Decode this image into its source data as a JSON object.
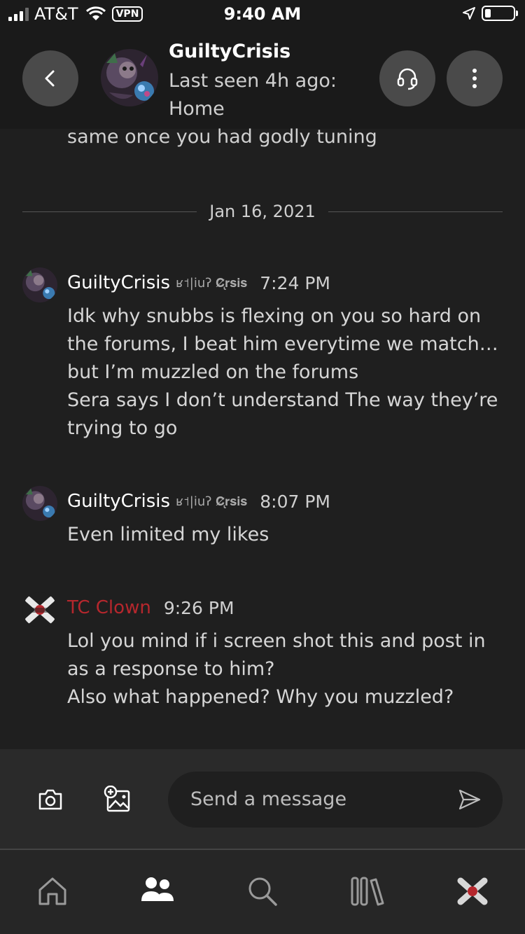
{
  "status_bar": {
    "carrier": "AT&T",
    "vpn": "VPN",
    "time": "9:40 AM"
  },
  "header": {
    "name": "GuiltyCrisis",
    "status": "Last seen 4h ago: Home",
    "icons": [
      "back-arrow-icon",
      "headset-icon",
      "more-vertical-icon"
    ]
  },
  "partial_message": "same once you had godly tuning",
  "date_separator": "Jan 16, 2021",
  "messages": [
    {
      "name": "GuiltyCrisis",
      "tag": "ʁ˦|iuʔ 𝐂̷̢𝐫𝐬𝐢𝐬",
      "time": "7:24 PM",
      "lines": [
        "Idk why snubbs is flexing on you so hard on the forums, I beat him everytime we match… but I’m muzzled on the forums",
        "Sera says I don’t understand    The way they’re trying to go"
      ]
    },
    {
      "name": "GuiltyCrisis",
      "tag": "ʁ˦|iuʔ 𝐂̷̢𝐫𝐬𝐢𝐬",
      "time": "8:07 PM",
      "lines": [
        "Even limited my likes"
      ]
    },
    {
      "name": "TC Clown",
      "time": "9:26 PM",
      "name_color": "#b5272d",
      "lines": [
        "Lol you mind if i screen shot this and post in as a response to him?",
        "Also what happened? Why you muzzled?"
      ]
    }
  ],
  "composer": {
    "placeholder": "Send a message",
    "icons": [
      "camera-icon",
      "add-image-icon",
      "send-icon"
    ]
  },
  "tabbar": {
    "icons": [
      "home-icon",
      "friends-icon",
      "search-icon",
      "library-icon",
      "profile-avatar"
    ]
  },
  "colors": {
    "background": "#1f1f1f",
    "header": "#1a1a1a",
    "button": "#4a4a4a",
    "accent_red": "#b5272d"
  }
}
